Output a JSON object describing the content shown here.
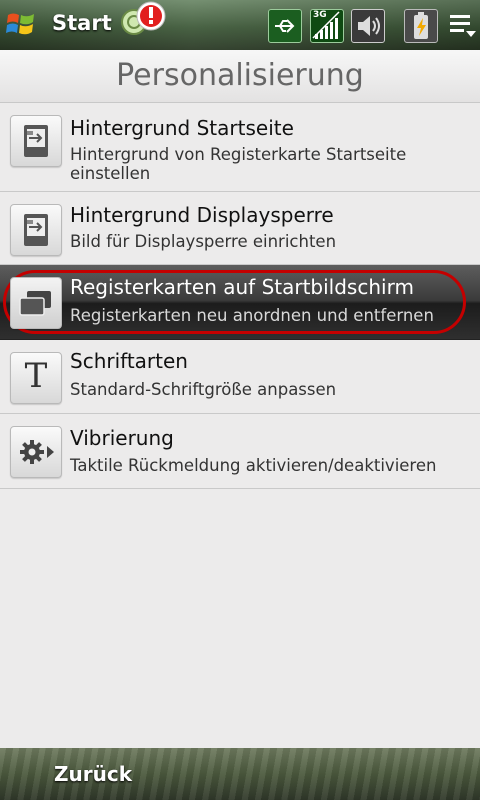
{
  "statusbar": {
    "start_label": "Start",
    "icons": [
      "windows-logo-icon",
      "notification-alert-icon",
      "usb-icon",
      "signal-3g-icon",
      "speaker-icon",
      "battery-charging-icon",
      "menu-icon"
    ],
    "signal_label": "3G"
  },
  "header": {
    "title": "Personalisierung"
  },
  "items": [
    {
      "title": "Hintergrund Startseite",
      "subtitle": "Hintergrund von Registerkarte Startseite einstellen",
      "icon": "wallpaper-icon"
    },
    {
      "title": "Hintergrund Displaysperre",
      "subtitle": "Bild für Displaysperre einrichten",
      "icon": "lockscreen-wallpaper-icon"
    },
    {
      "title": "Registerkarten auf Startbildschirm",
      "subtitle": "Registerkarten neu anordnen und entfernen",
      "icon": "tabs-icon",
      "selected": true
    },
    {
      "title": "Schriftarten",
      "subtitle": "Standard-Schriftgröße anpassen",
      "icon": "font-icon"
    },
    {
      "title": "Vibrierung",
      "subtitle": "Taktile Rückmeldung aktivieren/deaktivieren",
      "icon": "vibration-gear-icon"
    }
  ],
  "bottombar": {
    "back_label": "Zurück"
  },
  "colors": {
    "highlight_ring": "#c40000",
    "selected_row": "#2f2f2f",
    "list_bg": "#ecebeb"
  }
}
